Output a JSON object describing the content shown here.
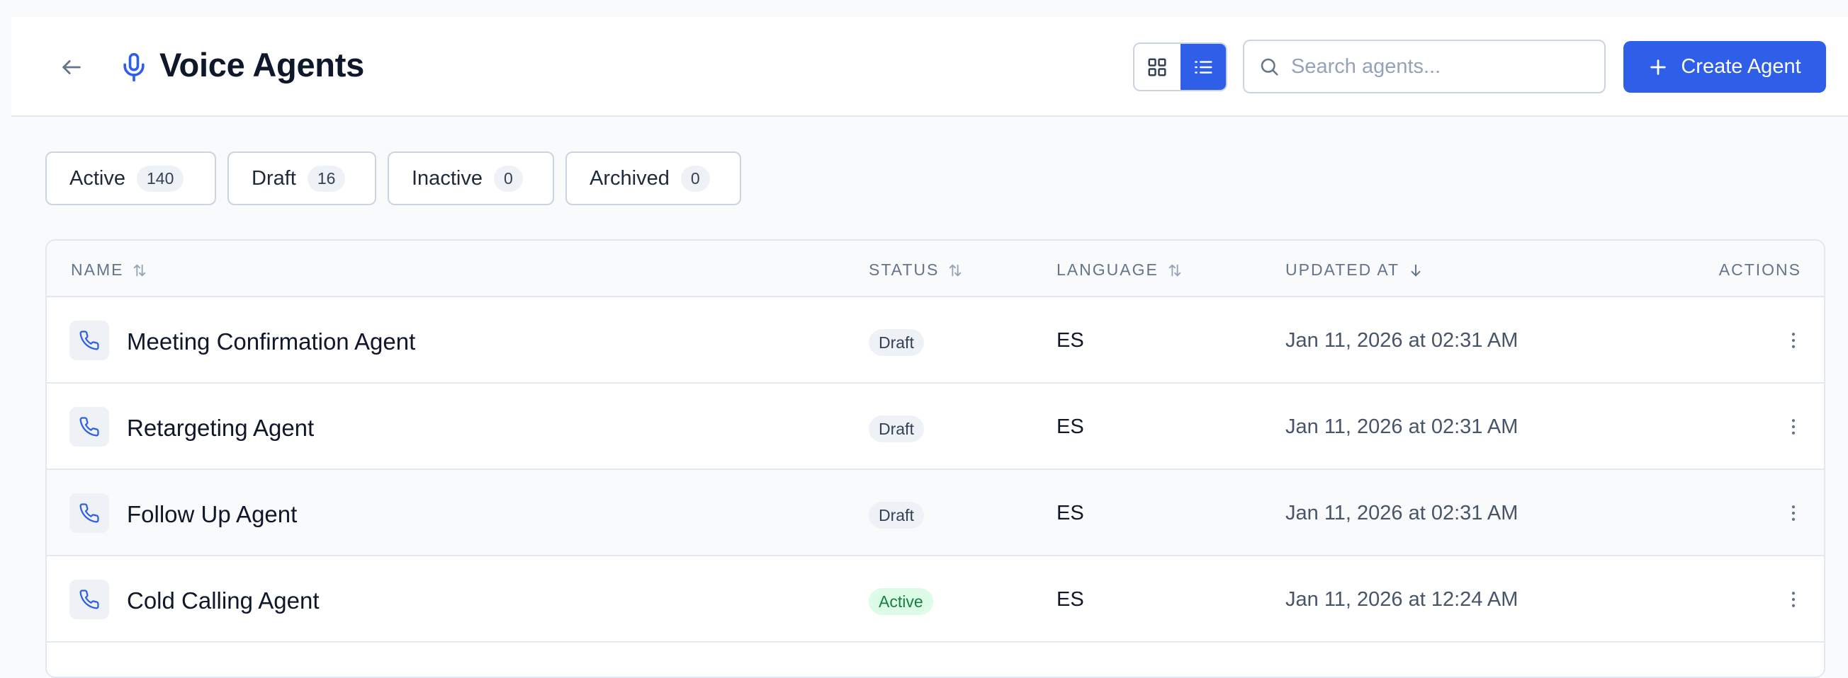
{
  "header": {
    "title": "Voice Agents",
    "search_placeholder": "Search agents...",
    "create_label": "Create Agent",
    "view_mode": "list"
  },
  "filters": [
    {
      "label": "Active",
      "count": "140"
    },
    {
      "label": "Draft",
      "count": "16"
    },
    {
      "label": "Inactive",
      "count": "0"
    },
    {
      "label": "Archived",
      "count": "0"
    }
  ],
  "table": {
    "columns": {
      "name": "NAME",
      "status": "STATUS",
      "language": "LANGUAGE",
      "updated_at": "UPDATED AT",
      "actions": "ACTIONS"
    },
    "rows": [
      {
        "name": "Meeting Confirmation Agent",
        "status": "Draft",
        "language": "ES",
        "updated_at": "Jan 11, 2026 at 02:31 AM"
      },
      {
        "name": "Retargeting Agent",
        "status": "Draft",
        "language": "ES",
        "updated_at": "Jan 11, 2026 at 02:31 AM"
      },
      {
        "name": "Follow Up Agent",
        "status": "Draft",
        "language": "ES",
        "updated_at": "Jan 11, 2026 at 02:31 AM"
      },
      {
        "name": "Cold Calling Agent",
        "status": "Active",
        "language": "ES",
        "updated_at": "Jan 11, 2026 at 12:24 AM"
      }
    ]
  },
  "colors": {
    "accent": "#2f5ee8",
    "active_badge_bg": "#dcfce7",
    "active_badge_text": "#15803d",
    "draft_badge_bg": "#eef2f7"
  }
}
